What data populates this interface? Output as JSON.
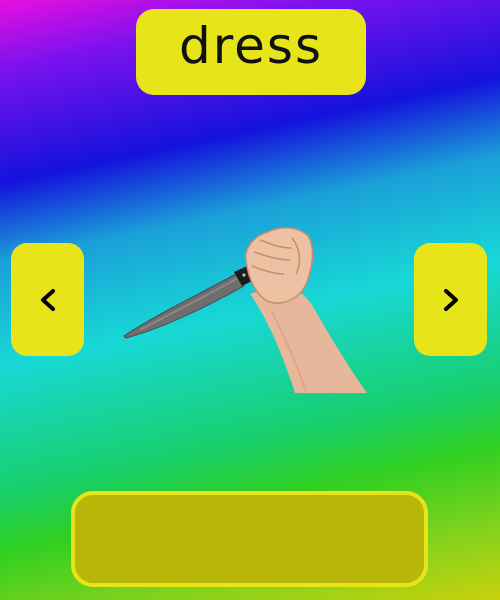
{
  "word": {
    "text": "dress"
  },
  "nav": {
    "prev_icon": "chevron-left-icon",
    "next_icon": "chevron-right-icon"
  },
  "picture": {
    "depicts": "knife-in-hand"
  },
  "answer": {
    "value": ""
  },
  "colors": {
    "accent": "#e8e41a",
    "answer_fill": "#b9b60a",
    "text": "#111111"
  }
}
